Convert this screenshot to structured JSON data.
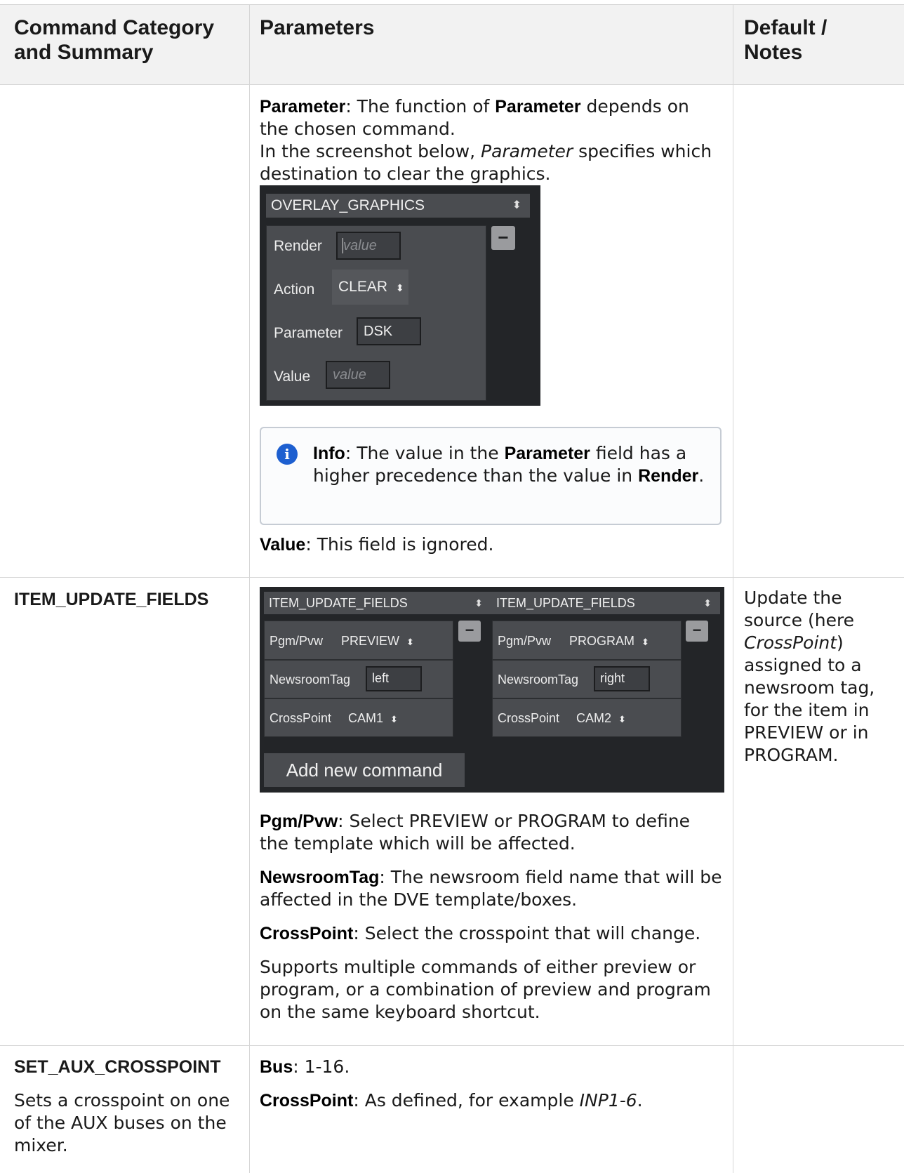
{
  "table": {
    "headers": [
      "Command Category and Summary",
      "Parameters",
      "Default / Notes"
    ],
    "header_lines": {
      "col1": [
        "Command Category",
        "and Summary"
      ],
      "col2": [
        "Parameters"
      ],
      "col3": [
        "Default /",
        "Notes"
      ]
    }
  },
  "row1": {
    "param_text": {
      "bold": "Parameter",
      "rest1": ": The function of ",
      "bold2": "Parameter",
      "rest2": " depends on the chosen command.",
      "line2_start": "In the screenshot below, ",
      "italic": "Parameter",
      "line2_end": " specifies which destination to clear the graphics."
    },
    "screenshot": {
      "command": "OVERLAY_GRAPHICS",
      "fields": [
        {
          "label": "Render",
          "value": "",
          "placeholder": "value"
        },
        {
          "label": "Action",
          "value": "CLEAR"
        },
        {
          "label": "Parameter",
          "value": "DSK"
        },
        {
          "label": "Value",
          "value": "",
          "placeholder": "value"
        }
      ],
      "remove_label": "−",
      "dropdown_arrow": "⬍"
    },
    "info": {
      "icon": "i",
      "bold1": "Info",
      "text1": ": The value in the ",
      "bold2": "Parameter",
      "text2": " field has a higher precedence than the value in ",
      "bold3": "Render",
      "text3": "."
    },
    "value_note": {
      "bold": "Value",
      "text": ": This field is ignored."
    }
  },
  "row2": {
    "command": "ITEM_UPDATE_FIELDS",
    "screenshot": {
      "left": {
        "command": "ITEM_UPDATE_FIELDS",
        "fields": [
          {
            "label": "Pgm/Pvw",
            "value": "PREVIEW"
          },
          {
            "label": "NewsroomTag",
            "value": "left"
          },
          {
            "label": "CrossPoint",
            "value": "CAM1"
          }
        ]
      },
      "right": {
        "command": "ITEM_UPDATE_FIELDS",
        "fields": [
          {
            "label": "Pgm/Pvw",
            "value": "PROGRAM"
          },
          {
            "label": "NewsroomTag",
            "value": "right"
          },
          {
            "label": "CrossPoint",
            "value": "CAM2"
          }
        ]
      },
      "add_button": "Add new command"
    },
    "params": [
      {
        "bold": "Pgm/Pvw",
        "text": ": Select PREVIEW or PROGRAM to define the template which will be affected."
      },
      {
        "bold": "NewsroomTag",
        "text": ": The newsroom field name that will be affected in the DVE template/boxes."
      },
      {
        "bold": "CrossPoint",
        "text": ": Select the crosspoint that will change."
      },
      {
        "bold": "",
        "text": "Supports multiple commands of either preview or program, or a combination of preview and program on the same keyboard shortcut."
      }
    ],
    "notes": {
      "start": "Update the source (here ",
      "italic": "CrossPoint",
      "end": ") assigned to a newsroom tag, for the item in PREVIEW or in PROGRAM."
    }
  },
  "row3": {
    "command": "SET_AUX_CROSSPOINT",
    "summary": "Sets a crosspoint on one of the AUX buses on the mixer.",
    "params": [
      {
        "bold": "Bus",
        "text": ": 1-16."
      },
      {
        "bold": "CrossPoint",
        "text": ": As defined, for example ",
        "italic": "INP1-6",
        "end": "."
      }
    ]
  }
}
